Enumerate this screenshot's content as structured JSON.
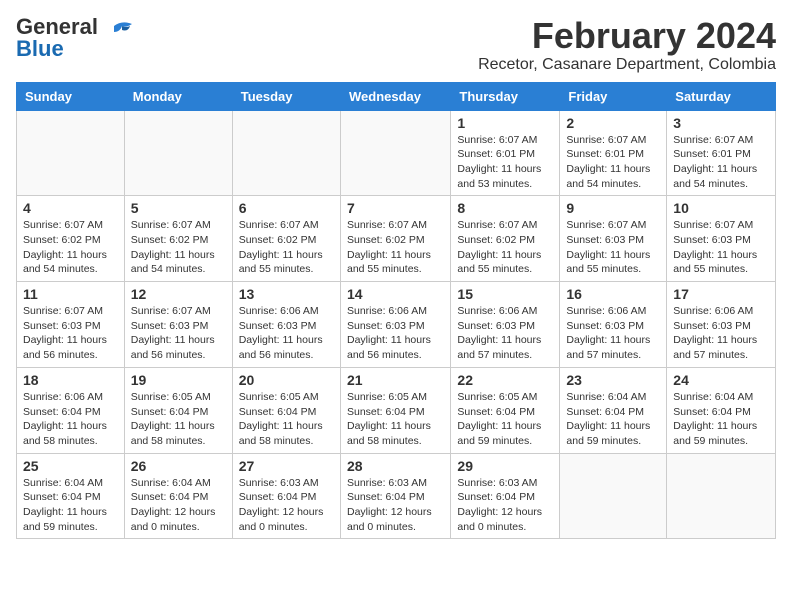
{
  "header": {
    "logo_general": "General",
    "logo_blue": "Blue",
    "month_title": "February 2024",
    "location": "Recetor, Casanare Department, Colombia"
  },
  "weekdays": [
    "Sunday",
    "Monday",
    "Tuesday",
    "Wednesday",
    "Thursday",
    "Friday",
    "Saturday"
  ],
  "weeks": [
    [
      {
        "day": "",
        "info": ""
      },
      {
        "day": "",
        "info": ""
      },
      {
        "day": "",
        "info": ""
      },
      {
        "day": "",
        "info": ""
      },
      {
        "day": "1",
        "info": "Sunrise: 6:07 AM\nSunset: 6:01 PM\nDaylight: 11 hours\nand 53 minutes."
      },
      {
        "day": "2",
        "info": "Sunrise: 6:07 AM\nSunset: 6:01 PM\nDaylight: 11 hours\nand 54 minutes."
      },
      {
        "day": "3",
        "info": "Sunrise: 6:07 AM\nSunset: 6:01 PM\nDaylight: 11 hours\nand 54 minutes."
      }
    ],
    [
      {
        "day": "4",
        "info": "Sunrise: 6:07 AM\nSunset: 6:02 PM\nDaylight: 11 hours\nand 54 minutes."
      },
      {
        "day": "5",
        "info": "Sunrise: 6:07 AM\nSunset: 6:02 PM\nDaylight: 11 hours\nand 54 minutes."
      },
      {
        "day": "6",
        "info": "Sunrise: 6:07 AM\nSunset: 6:02 PM\nDaylight: 11 hours\nand 55 minutes."
      },
      {
        "day": "7",
        "info": "Sunrise: 6:07 AM\nSunset: 6:02 PM\nDaylight: 11 hours\nand 55 minutes."
      },
      {
        "day": "8",
        "info": "Sunrise: 6:07 AM\nSunset: 6:02 PM\nDaylight: 11 hours\nand 55 minutes."
      },
      {
        "day": "9",
        "info": "Sunrise: 6:07 AM\nSunset: 6:03 PM\nDaylight: 11 hours\nand 55 minutes."
      },
      {
        "day": "10",
        "info": "Sunrise: 6:07 AM\nSunset: 6:03 PM\nDaylight: 11 hours\nand 55 minutes."
      }
    ],
    [
      {
        "day": "11",
        "info": "Sunrise: 6:07 AM\nSunset: 6:03 PM\nDaylight: 11 hours\nand 56 minutes."
      },
      {
        "day": "12",
        "info": "Sunrise: 6:07 AM\nSunset: 6:03 PM\nDaylight: 11 hours\nand 56 minutes."
      },
      {
        "day": "13",
        "info": "Sunrise: 6:06 AM\nSunset: 6:03 PM\nDaylight: 11 hours\nand 56 minutes."
      },
      {
        "day": "14",
        "info": "Sunrise: 6:06 AM\nSunset: 6:03 PM\nDaylight: 11 hours\nand 56 minutes."
      },
      {
        "day": "15",
        "info": "Sunrise: 6:06 AM\nSunset: 6:03 PM\nDaylight: 11 hours\nand 57 minutes."
      },
      {
        "day": "16",
        "info": "Sunrise: 6:06 AM\nSunset: 6:03 PM\nDaylight: 11 hours\nand 57 minutes."
      },
      {
        "day": "17",
        "info": "Sunrise: 6:06 AM\nSunset: 6:03 PM\nDaylight: 11 hours\nand 57 minutes."
      }
    ],
    [
      {
        "day": "18",
        "info": "Sunrise: 6:06 AM\nSunset: 6:04 PM\nDaylight: 11 hours\nand 58 minutes."
      },
      {
        "day": "19",
        "info": "Sunrise: 6:05 AM\nSunset: 6:04 PM\nDaylight: 11 hours\nand 58 minutes."
      },
      {
        "day": "20",
        "info": "Sunrise: 6:05 AM\nSunset: 6:04 PM\nDaylight: 11 hours\nand 58 minutes."
      },
      {
        "day": "21",
        "info": "Sunrise: 6:05 AM\nSunset: 6:04 PM\nDaylight: 11 hours\nand 58 minutes."
      },
      {
        "day": "22",
        "info": "Sunrise: 6:05 AM\nSunset: 6:04 PM\nDaylight: 11 hours\nand 59 minutes."
      },
      {
        "day": "23",
        "info": "Sunrise: 6:04 AM\nSunset: 6:04 PM\nDaylight: 11 hours\nand 59 minutes."
      },
      {
        "day": "24",
        "info": "Sunrise: 6:04 AM\nSunset: 6:04 PM\nDaylight: 11 hours\nand 59 minutes."
      }
    ],
    [
      {
        "day": "25",
        "info": "Sunrise: 6:04 AM\nSunset: 6:04 PM\nDaylight: 11 hours\nand 59 minutes."
      },
      {
        "day": "26",
        "info": "Sunrise: 6:04 AM\nSunset: 6:04 PM\nDaylight: 12 hours\nand 0 minutes."
      },
      {
        "day": "27",
        "info": "Sunrise: 6:03 AM\nSunset: 6:04 PM\nDaylight: 12 hours\nand 0 minutes."
      },
      {
        "day": "28",
        "info": "Sunrise: 6:03 AM\nSunset: 6:04 PM\nDaylight: 12 hours\nand 0 minutes."
      },
      {
        "day": "29",
        "info": "Sunrise: 6:03 AM\nSunset: 6:04 PM\nDaylight: 12 hours\nand 0 minutes."
      },
      {
        "day": "",
        "info": ""
      },
      {
        "day": "",
        "info": ""
      }
    ]
  ]
}
